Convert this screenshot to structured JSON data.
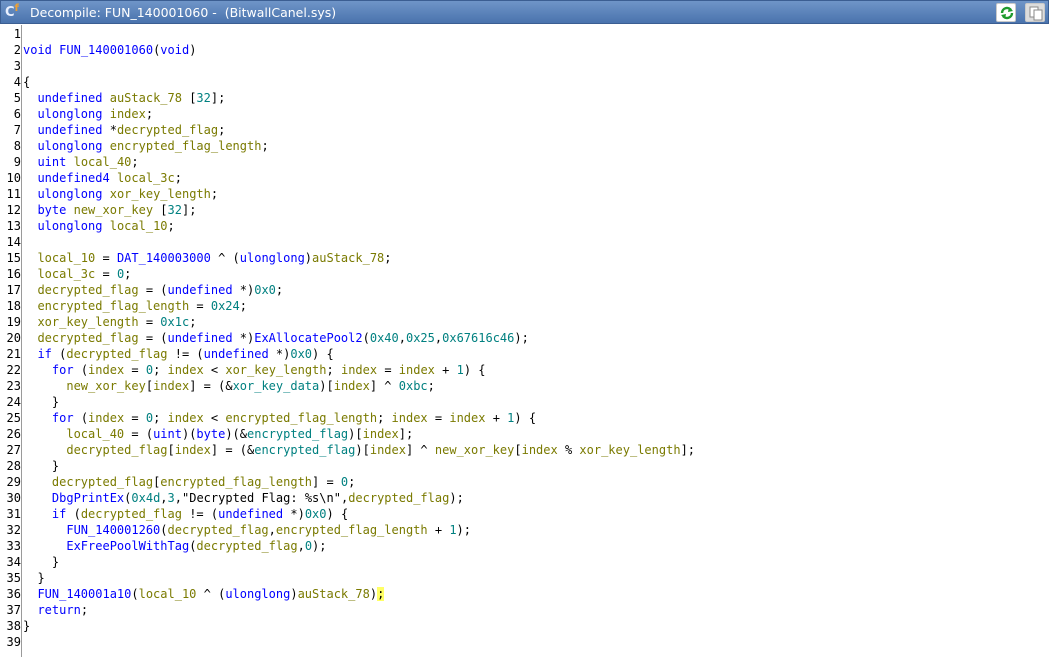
{
  "window": {
    "title": "Decompile: FUN_140001060 -  (BitwallCanel.sys)",
    "icon": "decompiler-icon",
    "buttons": [
      {
        "name": "refresh-button",
        "icon": "refresh-icon"
      },
      {
        "name": "copy-button",
        "icon": "copy-icon"
      }
    ]
  },
  "colors": {
    "keyword": "#0000ff",
    "local_var": "#7a7a00",
    "global": "#008080",
    "highlight": "#ffff66",
    "titlebar": "#4a73ad"
  },
  "lines": [
    [],
    [
      [
        "void",
        "kw"
      ],
      [
        " ",
        ""
      ],
      [
        "FUN_140001060",
        "fn"
      ],
      [
        "(",
        "op"
      ],
      [
        "void",
        "kw"
      ],
      [
        ")",
        "op"
      ]
    ],
    [],
    [
      [
        "{",
        "op"
      ]
    ],
    [
      [
        "  ",
        ""
      ],
      [
        "undefined",
        "type"
      ],
      [
        " ",
        ""
      ],
      [
        "auStack_78",
        "lvar"
      ],
      [
        " [",
        "op"
      ],
      [
        "32",
        "num"
      ],
      [
        "];",
        "op"
      ]
    ],
    [
      [
        "  ",
        ""
      ],
      [
        "ulonglong",
        "type"
      ],
      [
        " ",
        ""
      ],
      [
        "index",
        "lvar"
      ],
      [
        ";",
        "op"
      ]
    ],
    [
      [
        "  ",
        ""
      ],
      [
        "undefined",
        "type"
      ],
      [
        " *",
        "op"
      ],
      [
        "decrypted_flag",
        "lvar"
      ],
      [
        ";",
        "op"
      ]
    ],
    [
      [
        "  ",
        ""
      ],
      [
        "ulonglong",
        "type"
      ],
      [
        " ",
        ""
      ],
      [
        "encrypted_flag_length",
        "lvar"
      ],
      [
        ";",
        "op"
      ]
    ],
    [
      [
        "  ",
        ""
      ],
      [
        "uint",
        "type"
      ],
      [
        " ",
        ""
      ],
      [
        "local_40",
        "lvar"
      ],
      [
        ";",
        "op"
      ]
    ],
    [
      [
        "  ",
        ""
      ],
      [
        "undefined4",
        "type"
      ],
      [
        " ",
        ""
      ],
      [
        "local_3c",
        "lvar"
      ],
      [
        ";",
        "op"
      ]
    ],
    [
      [
        "  ",
        ""
      ],
      [
        "ulonglong",
        "type"
      ],
      [
        " ",
        ""
      ],
      [
        "xor_key_length",
        "lvar"
      ],
      [
        ";",
        "op"
      ]
    ],
    [
      [
        "  ",
        ""
      ],
      [
        "byte",
        "type"
      ],
      [
        " ",
        ""
      ],
      [
        "new_xor_key",
        "lvar"
      ],
      [
        " [",
        "op"
      ],
      [
        "32",
        "num"
      ],
      [
        "];",
        "op"
      ]
    ],
    [
      [
        "  ",
        ""
      ],
      [
        "ulonglong",
        "type"
      ],
      [
        " ",
        ""
      ],
      [
        "local_10",
        "lvar"
      ],
      [
        ";",
        "op"
      ]
    ],
    [],
    [
      [
        "  ",
        ""
      ],
      [
        "local_10",
        "lvar"
      ],
      [
        " = ",
        "op"
      ],
      [
        "DAT_140003000",
        "fn"
      ],
      [
        " ^ (",
        "op"
      ],
      [
        "ulonglong",
        "type"
      ],
      [
        ")",
        "op"
      ],
      [
        "auStack_78",
        "lvar"
      ],
      [
        ";",
        "op"
      ]
    ],
    [
      [
        "  ",
        ""
      ],
      [
        "local_3c",
        "lvar"
      ],
      [
        " = ",
        "op"
      ],
      [
        "0",
        "num"
      ],
      [
        ";",
        "op"
      ]
    ],
    [
      [
        "  ",
        ""
      ],
      [
        "decrypted_flag",
        "lvar"
      ],
      [
        " = (",
        "op"
      ],
      [
        "undefined",
        "type"
      ],
      [
        " *)",
        "op"
      ],
      [
        "0x0",
        "num"
      ],
      [
        ";",
        "op"
      ]
    ],
    [
      [
        "  ",
        ""
      ],
      [
        "encrypted_flag_length",
        "lvar"
      ],
      [
        " = ",
        "op"
      ],
      [
        "0x24",
        "num"
      ],
      [
        ";",
        "op"
      ]
    ],
    [
      [
        "  ",
        ""
      ],
      [
        "xor_key_length",
        "lvar"
      ],
      [
        " = ",
        "op"
      ],
      [
        "0x1c",
        "num"
      ],
      [
        ";",
        "op"
      ]
    ],
    [
      [
        "  ",
        ""
      ],
      [
        "decrypted_flag",
        "lvar"
      ],
      [
        " = (",
        "op"
      ],
      [
        "undefined",
        "type"
      ],
      [
        " *)",
        "op"
      ],
      [
        "ExAllocatePool2",
        "fn"
      ],
      [
        "(",
        "op"
      ],
      [
        "0x40",
        "num"
      ],
      [
        ",",
        "op"
      ],
      [
        "0x25",
        "num"
      ],
      [
        ",",
        "op"
      ],
      [
        "0x67616c46",
        "num"
      ],
      [
        ");",
        "op"
      ]
    ],
    [
      [
        "  ",
        ""
      ],
      [
        "if",
        "kw"
      ],
      [
        " (",
        "op"
      ],
      [
        "decrypted_flag",
        "lvar"
      ],
      [
        " != (",
        "op"
      ],
      [
        "undefined",
        "type"
      ],
      [
        " *)",
        "op"
      ],
      [
        "0x0",
        "num"
      ],
      [
        ") {",
        "op"
      ]
    ],
    [
      [
        "    ",
        ""
      ],
      [
        "for",
        "kw"
      ],
      [
        " (",
        "op"
      ],
      [
        "index",
        "lvar"
      ],
      [
        " = ",
        "op"
      ],
      [
        "0",
        "num"
      ],
      [
        "; ",
        "op"
      ],
      [
        "index",
        "lvar"
      ],
      [
        " < ",
        "op"
      ],
      [
        "xor_key_length",
        "lvar"
      ],
      [
        "; ",
        "op"
      ],
      [
        "index",
        "lvar"
      ],
      [
        " = ",
        "op"
      ],
      [
        "index",
        "lvar"
      ],
      [
        " + ",
        "op"
      ],
      [
        "1",
        "num"
      ],
      [
        ") {",
        "op"
      ]
    ],
    [
      [
        "      ",
        ""
      ],
      [
        "new_xor_key",
        "lvar"
      ],
      [
        "[",
        "op"
      ],
      [
        "index",
        "lvar"
      ],
      [
        "] = (&",
        "op"
      ],
      [
        "xor_key_data",
        "glob"
      ],
      [
        ")[",
        "op"
      ],
      [
        "index",
        "lvar"
      ],
      [
        "] ^ ",
        "op"
      ],
      [
        "0xbc",
        "num"
      ],
      [
        ";",
        "op"
      ]
    ],
    [
      [
        "    ",
        ""
      ],
      [
        "}",
        "op"
      ]
    ],
    [
      [
        "    ",
        ""
      ],
      [
        "for",
        "kw"
      ],
      [
        " (",
        "op"
      ],
      [
        "index",
        "lvar"
      ],
      [
        " = ",
        "op"
      ],
      [
        "0",
        "num"
      ],
      [
        "; ",
        "op"
      ],
      [
        "index",
        "lvar"
      ],
      [
        " < ",
        "op"
      ],
      [
        "encrypted_flag_length",
        "lvar"
      ],
      [
        "; ",
        "op"
      ],
      [
        "index",
        "lvar"
      ],
      [
        " = ",
        "op"
      ],
      [
        "index",
        "lvar"
      ],
      [
        " + ",
        "op"
      ],
      [
        "1",
        "num"
      ],
      [
        ") {",
        "op"
      ]
    ],
    [
      [
        "      ",
        ""
      ],
      [
        "local_40",
        "lvar"
      ],
      [
        " = (",
        "op"
      ],
      [
        "uint",
        "type"
      ],
      [
        ")(",
        "op"
      ],
      [
        "byte",
        "type"
      ],
      [
        ")(&",
        "op"
      ],
      [
        "encrypted_flag",
        "glob"
      ],
      [
        ")[",
        "op"
      ],
      [
        "index",
        "lvar"
      ],
      [
        "];",
        "op"
      ]
    ],
    [
      [
        "      ",
        ""
      ],
      [
        "decrypted_flag",
        "lvar"
      ],
      [
        "[",
        "op"
      ],
      [
        "index",
        "lvar"
      ],
      [
        "] = (&",
        "op"
      ],
      [
        "encrypted_flag",
        "glob"
      ],
      [
        ")[",
        "op"
      ],
      [
        "index",
        "lvar"
      ],
      [
        "] ^ ",
        "op"
      ],
      [
        "new_xor_key",
        "lvar"
      ],
      [
        "[",
        "op"
      ],
      [
        "index",
        "lvar"
      ],
      [
        " % ",
        "op"
      ],
      [
        "xor_key_length",
        "lvar"
      ],
      [
        "];",
        "op"
      ]
    ],
    [
      [
        "    ",
        ""
      ],
      [
        "}",
        "op"
      ]
    ],
    [
      [
        "    ",
        ""
      ],
      [
        "decrypted_flag",
        "lvar"
      ],
      [
        "[",
        "op"
      ],
      [
        "encrypted_flag_length",
        "lvar"
      ],
      [
        "] = ",
        "op"
      ],
      [
        "0",
        "num"
      ],
      [
        ";",
        "op"
      ]
    ],
    [
      [
        "    ",
        ""
      ],
      [
        "DbgPrintEx",
        "fn"
      ],
      [
        "(",
        "op"
      ],
      [
        "0x4d",
        "num"
      ],
      [
        ",",
        "op"
      ],
      [
        "3",
        "num"
      ],
      [
        ",",
        "op"
      ],
      [
        "\"Decrypted Flag: %s\\n\"",
        "str"
      ],
      [
        ",",
        "op"
      ],
      [
        "decrypted_flag",
        "lvar"
      ],
      [
        ");",
        "op"
      ]
    ],
    [
      [
        "    ",
        ""
      ],
      [
        "if",
        "kw"
      ],
      [
        " (",
        "op"
      ],
      [
        "decrypted_flag",
        "lvar"
      ],
      [
        " != (",
        "op"
      ],
      [
        "undefined",
        "type"
      ],
      [
        " *)",
        "op"
      ],
      [
        "0x0",
        "num"
      ],
      [
        ") {",
        "op"
      ]
    ],
    [
      [
        "      ",
        ""
      ],
      [
        "FUN_140001260",
        "fn"
      ],
      [
        "(",
        "op"
      ],
      [
        "decrypted_flag",
        "lvar"
      ],
      [
        ",",
        "op"
      ],
      [
        "encrypted_flag_length",
        "lvar"
      ],
      [
        " + ",
        "op"
      ],
      [
        "1",
        "num"
      ],
      [
        ");",
        "op"
      ]
    ],
    [
      [
        "      ",
        ""
      ],
      [
        "ExFreePoolWithTag",
        "fn"
      ],
      [
        "(",
        "op"
      ],
      [
        "decrypted_flag",
        "lvar"
      ],
      [
        ",",
        "op"
      ],
      [
        "0",
        "num"
      ],
      [
        ");",
        "op"
      ]
    ],
    [
      [
        "    ",
        ""
      ],
      [
        "}",
        "op"
      ]
    ],
    [
      [
        "  ",
        ""
      ],
      [
        "}",
        "op"
      ]
    ],
    [
      [
        "  ",
        ""
      ],
      [
        "FUN_140001a10",
        "fn"
      ],
      [
        "(",
        "op"
      ],
      [
        "local_10",
        "lvar"
      ],
      [
        " ^ (",
        "op"
      ],
      [
        "ulonglong",
        "type"
      ],
      [
        ")",
        "op"
      ],
      [
        "auStack_78",
        "lvar"
      ],
      [
        ")",
        "op"
      ],
      [
        ";",
        "hl"
      ]
    ],
    [
      [
        "  ",
        ""
      ],
      [
        "return",
        "kw"
      ],
      [
        ";",
        "op"
      ]
    ],
    [
      [
        "}",
        "op"
      ]
    ],
    []
  ]
}
